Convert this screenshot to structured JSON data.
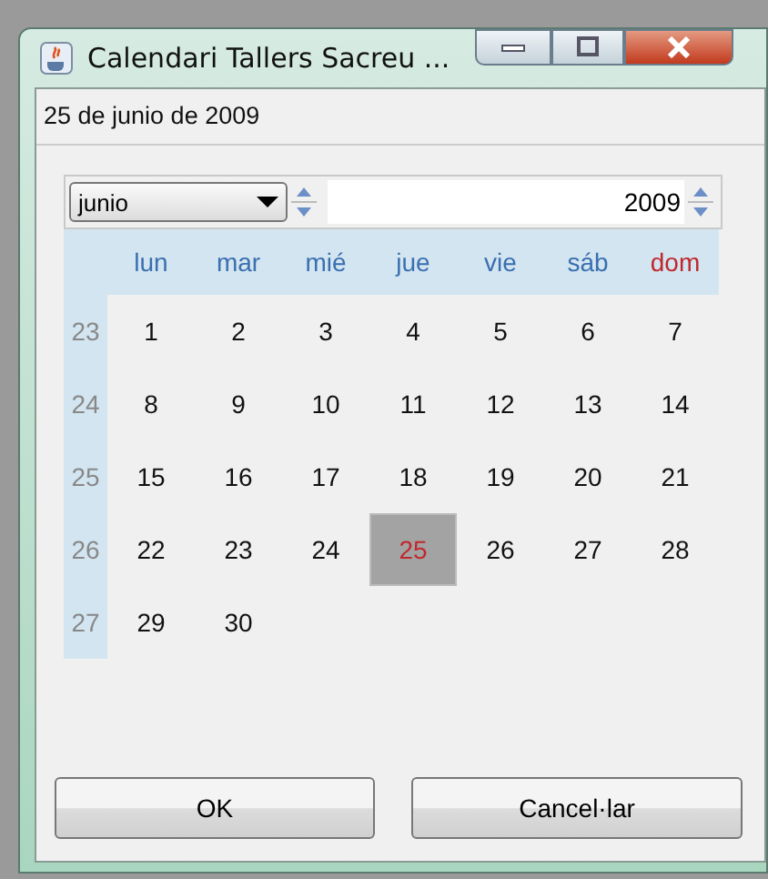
{
  "window": {
    "title": "Calendari Tallers Sacreu ..."
  },
  "date_field": {
    "value": "25 de junio de 2009"
  },
  "month_combo": {
    "value": "junio"
  },
  "year_spinner": {
    "value": "2009"
  },
  "weekdays": [
    {
      "label": "lun",
      "color": "#3a6fb0"
    },
    {
      "label": "mar",
      "color": "#3a6fb0"
    },
    {
      "label": "mié",
      "color": "#3a6fb0"
    },
    {
      "label": "jue",
      "color": "#3a6fb0"
    },
    {
      "label": "vie",
      "color": "#3a6fb0"
    },
    {
      "label": "sáb",
      "color": "#3a6fb0"
    },
    {
      "label": "dom",
      "color": "#c0282d"
    }
  ],
  "weeks": [
    {
      "number": "23",
      "days": [
        {
          "label": "1",
          "selected": false
        },
        {
          "label": "2",
          "selected": false
        },
        {
          "label": "3",
          "selected": false
        },
        {
          "label": "4",
          "selected": false
        },
        {
          "label": "5",
          "selected": false
        },
        {
          "label": "6",
          "selected": false
        },
        {
          "label": "7",
          "selected": false
        }
      ]
    },
    {
      "number": "24",
      "days": [
        {
          "label": "8",
          "selected": false
        },
        {
          "label": "9",
          "selected": false
        },
        {
          "label": "10",
          "selected": false
        },
        {
          "label": "11",
          "selected": false
        },
        {
          "label": "12",
          "selected": false
        },
        {
          "label": "13",
          "selected": false
        },
        {
          "label": "14",
          "selected": false
        }
      ]
    },
    {
      "number": "25",
      "days": [
        {
          "label": "15",
          "selected": false
        },
        {
          "label": "16",
          "selected": false
        },
        {
          "label": "17",
          "selected": false
        },
        {
          "label": "18",
          "selected": false
        },
        {
          "label": "19",
          "selected": false
        },
        {
          "label": "20",
          "selected": false
        },
        {
          "label": "21",
          "selected": false
        }
      ]
    },
    {
      "number": "26",
      "days": [
        {
          "label": "22",
          "selected": false
        },
        {
          "label": "23",
          "selected": false
        },
        {
          "label": "24",
          "selected": false
        },
        {
          "label": "25",
          "selected": true
        },
        {
          "label": "26",
          "selected": false
        },
        {
          "label": "27",
          "selected": false
        },
        {
          "label": "28",
          "selected": false
        }
      ]
    },
    {
      "number": "27",
      "days": [
        {
          "label": "29",
          "selected": false
        },
        {
          "label": "30",
          "selected": false
        }
      ]
    }
  ],
  "buttons": [
    "OK",
    "Cancel·lar"
  ]
}
